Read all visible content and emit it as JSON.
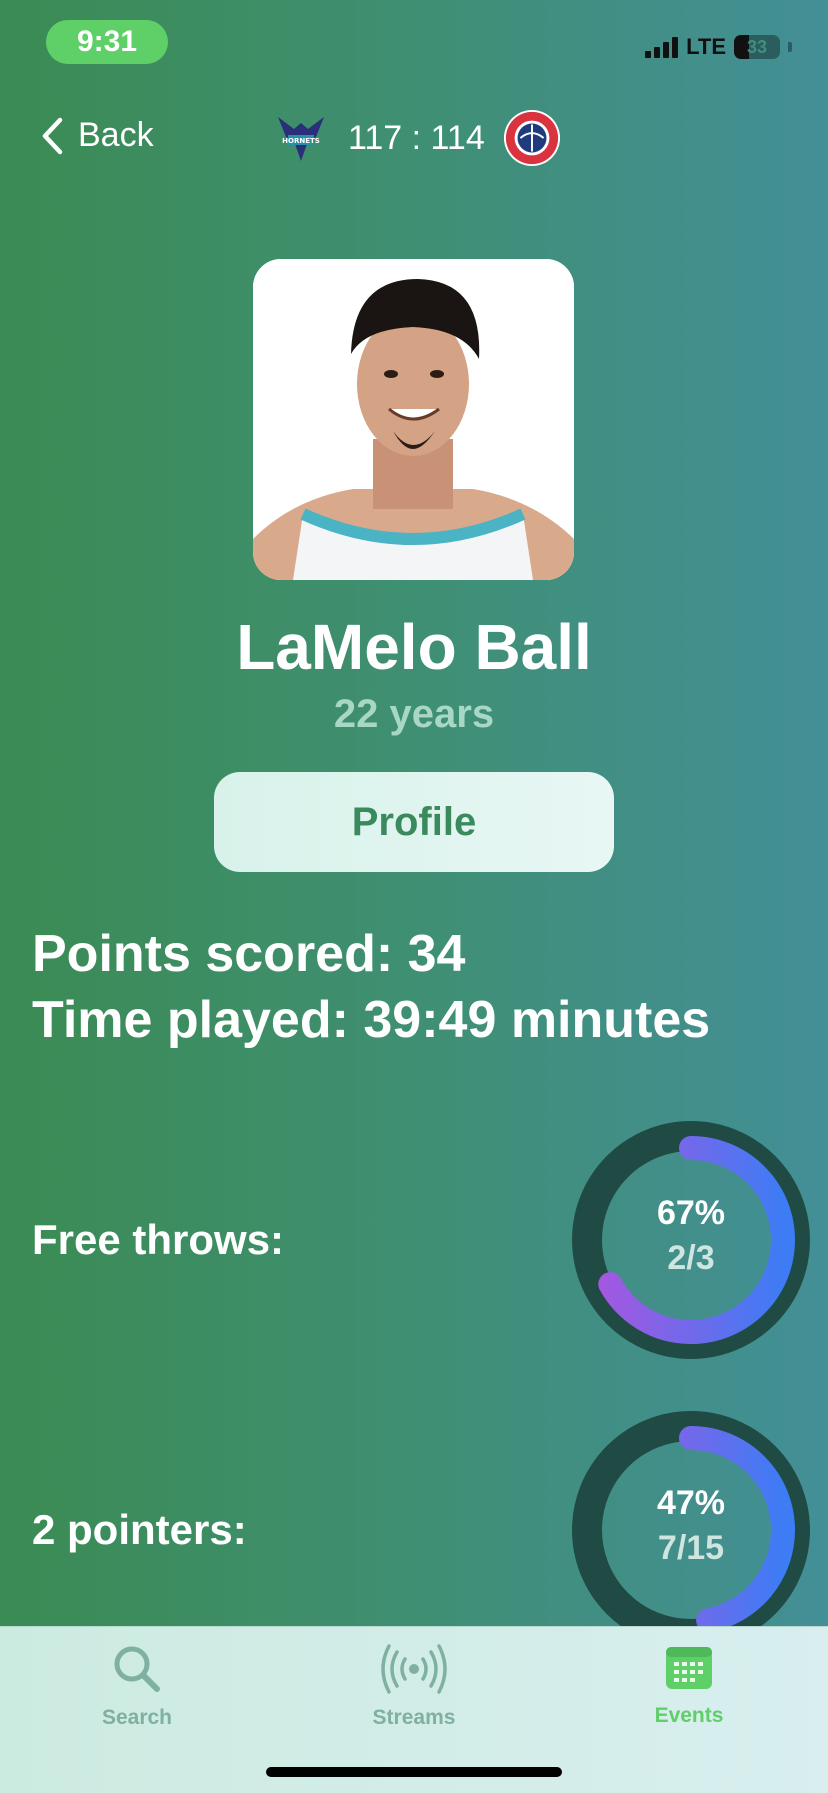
{
  "status": {
    "time": "9:31",
    "network": "LTE",
    "battery": "33"
  },
  "nav": {
    "back_label": "Back",
    "score": "117 : 114",
    "home_team_icon": "hornets-logo",
    "away_team_icon": "wizards-logo"
  },
  "player": {
    "name": "LaMelo Ball",
    "age": "22 years"
  },
  "profile_button": "Profile",
  "stats": {
    "points": "Points scored: 34",
    "time": "Time played: 39:49 minutes"
  },
  "rings": [
    {
      "label": "Free throws:",
      "percent": "67%",
      "fraction": "2/3",
      "value": 0.67
    },
    {
      "label": "2 pointers:",
      "percent": "47%",
      "fraction": "7/15",
      "value": 0.47
    }
  ],
  "tabs": [
    {
      "label": "Search",
      "icon": "search-icon"
    },
    {
      "label": "Streams",
      "icon": "broadcast-icon"
    },
    {
      "label": "Events",
      "icon": "calendar-icon"
    }
  ],
  "colors": {
    "tab_inactive": "#7fb0a0",
    "tab_active": "#5fcf68",
    "ring_track": "#1f4b44",
    "ring_start": "#3d7cf5",
    "ring_end": "#a557e0"
  }
}
